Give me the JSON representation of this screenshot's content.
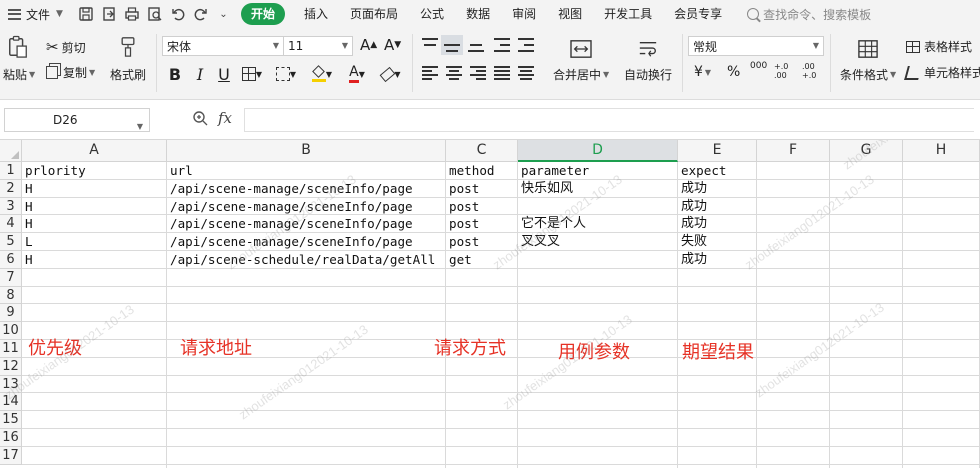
{
  "menubar": {
    "file_label": "文件",
    "tabs": [
      {
        "label": "开始",
        "active": true
      },
      {
        "label": "插入"
      },
      {
        "label": "页面布局"
      },
      {
        "label": "公式"
      },
      {
        "label": "数据"
      },
      {
        "label": "审阅"
      },
      {
        "label": "视图"
      },
      {
        "label": "开发工具"
      },
      {
        "label": "会员专享"
      }
    ],
    "search_placeholder": "查找命令、搜索模板"
  },
  "ribbon": {
    "paste": "粘贴",
    "cut": "剪切",
    "copy": "复制",
    "format_painter": "格式刷",
    "font_name": "宋体",
    "font_size": "11",
    "merge_center": "合并居中",
    "wrap_text": "自动换行",
    "number_format": "常规",
    "table_style": "表格样式",
    "conditional_format": "条件格式",
    "cell_style": "单元格样式",
    "bold": "B",
    "italic": "I",
    "underline": "U",
    "font_color_letter": "A",
    "currency": "¥",
    "percent": "%",
    "thousands": "000",
    "inc_decimal": "+.0 .00",
    "dec_decimal": ".00 +.0",
    "font_grow": "A",
    "font_shrink": "A"
  },
  "formula_bar": {
    "cell_ref": "D26",
    "fx": "fx",
    "content": ""
  },
  "sheet": {
    "columns": [
      "A",
      "B",
      "C",
      "D",
      "E",
      "F",
      "G",
      "H"
    ],
    "selected_column": "D",
    "row_numbers": [
      "1",
      "2",
      "3",
      "4",
      "5",
      "6",
      "7",
      "8",
      "9",
      "10",
      "11",
      "12",
      "13",
      "14",
      "15",
      "16",
      "17"
    ],
    "rows": [
      [
        "prlority",
        "url",
        "method",
        "parameter",
        "expect"
      ],
      [
        "H",
        "/api/scene-manage/sceneInfo/page",
        "post",
        "快乐如风",
        "成功"
      ],
      [
        "H",
        "/api/scene-manage/sceneInfo/page",
        "post",
        "",
        "成功"
      ],
      [
        "H",
        "/api/scene-manage/sceneInfo/page",
        "post",
        "它不是个人",
        "成功"
      ],
      [
        "L",
        "/api/scene-manage/sceneInfo/page",
        "post",
        "叉叉叉",
        "失败"
      ],
      [
        "H",
        "/api/scene-schedule/realData/getAll",
        "get",
        "",
        "成功"
      ]
    ],
    "annotations": [
      "优先级",
      "请求地址",
      "请求方式",
      "用例参数",
      "期望结果"
    ],
    "watermark": "zhoufeixiang012021-10-13"
  },
  "colors": {
    "accent": "#1d9e4f",
    "annotation": "#e63226"
  }
}
